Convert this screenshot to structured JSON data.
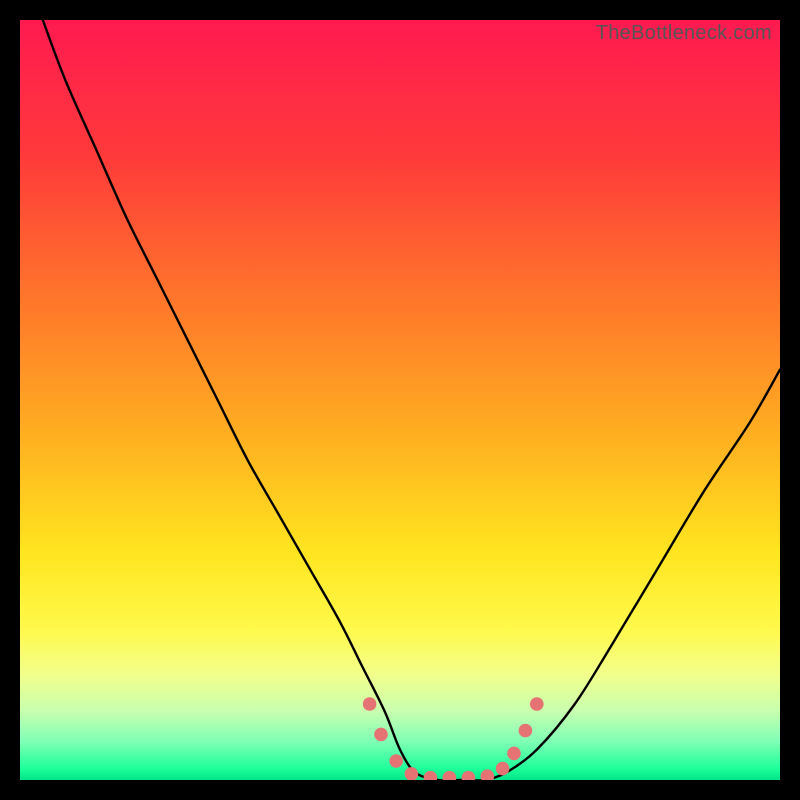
{
  "watermark": "TheBottleneck.com",
  "chart_data": {
    "type": "line",
    "title": "",
    "xlabel": "",
    "ylabel": "",
    "xlim": [
      0,
      100
    ],
    "ylim": [
      0,
      100
    ],
    "gradient_stops": [
      {
        "offset": 0.0,
        "color": "#ff1a50"
      },
      {
        "offset": 0.18,
        "color": "#ff3a3a"
      },
      {
        "offset": 0.38,
        "color": "#ff7a2a"
      },
      {
        "offset": 0.55,
        "color": "#ffb020"
      },
      {
        "offset": 0.7,
        "color": "#ffe51f"
      },
      {
        "offset": 0.8,
        "color": "#fff94a"
      },
      {
        "offset": 0.86,
        "color": "#f3ff8a"
      },
      {
        "offset": 0.91,
        "color": "#c8ffb0"
      },
      {
        "offset": 0.95,
        "color": "#7dffb5"
      },
      {
        "offset": 0.985,
        "color": "#1eff9a"
      },
      {
        "offset": 1.0,
        "color": "#00e58a"
      }
    ],
    "series": [
      {
        "name": "bottleneck-curve",
        "x": [
          3,
          6,
          10,
          14,
          18,
          22,
          26,
          30,
          34,
          38,
          42,
          45,
          48,
          50,
          52,
          55,
          58,
          61,
          64,
          68,
          73,
          78,
          84,
          90,
          96,
          100
        ],
        "y": [
          100,
          92,
          83,
          74,
          66,
          58,
          50,
          42,
          35,
          28,
          21,
          15,
          9,
          4,
          1,
          0,
          0,
          0,
          1,
          4,
          10,
          18,
          28,
          38,
          47,
          54
        ]
      }
    ],
    "markers": {
      "name": "highlight-dots",
      "color": "#e57373",
      "radius": 6.8,
      "points": [
        {
          "x": 46.0,
          "y": 10.0
        },
        {
          "x": 47.5,
          "y": 6.0
        },
        {
          "x": 49.5,
          "y": 2.5
        },
        {
          "x": 51.5,
          "y": 0.8
        },
        {
          "x": 54.0,
          "y": 0.3
        },
        {
          "x": 56.5,
          "y": 0.3
        },
        {
          "x": 59.0,
          "y": 0.3
        },
        {
          "x": 61.5,
          "y": 0.5
        },
        {
          "x": 63.5,
          "y": 1.5
        },
        {
          "x": 65.0,
          "y": 3.5
        },
        {
          "x": 66.5,
          "y": 6.5
        },
        {
          "x": 68.0,
          "y": 10.0
        }
      ]
    }
  }
}
